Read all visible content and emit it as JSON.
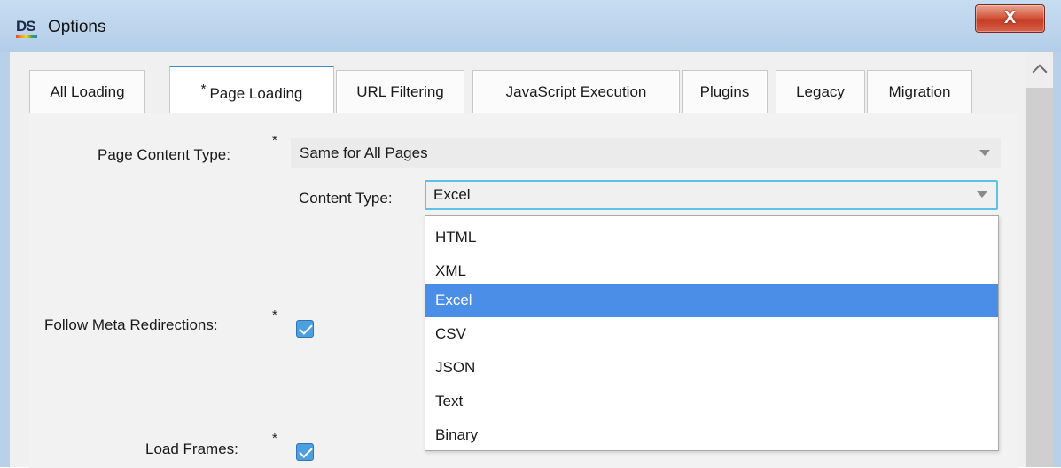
{
  "window": {
    "logo_text": "DS",
    "title": "Options",
    "close_label": "X"
  },
  "tabs": [
    {
      "label": "All Loading",
      "active": false,
      "modified": false
    },
    {
      "label": "Page Loading",
      "active": true,
      "modified": true,
      "marker": "*"
    },
    {
      "label": "URL Filtering",
      "active": false,
      "modified": false
    },
    {
      "label": "JavaScript Execution",
      "active": false,
      "modified": false
    },
    {
      "label": "Plugins",
      "active": false,
      "modified": false
    },
    {
      "label": "Legacy",
      "active": false,
      "modified": false
    },
    {
      "label": "Migration",
      "active": false,
      "modified": false
    }
  ],
  "form": {
    "page_content_type": {
      "label": "Page Content Type:",
      "marker": "*",
      "value": "Same for All Pages"
    },
    "content_type": {
      "label": "Content Type:",
      "value": "Excel",
      "options": [
        "HTML",
        "XML",
        "Excel",
        "CSV",
        "JSON",
        "Text",
        "Binary"
      ],
      "selected_index": 2
    },
    "follow_meta_redirections": {
      "label": "Follow Meta Redirections:",
      "marker": "*",
      "checked": true
    },
    "load_frames": {
      "label": "Load Frames:",
      "marker": "*",
      "checked": true
    }
  },
  "colors": {
    "accent": "#4a8ee7",
    "focus_border": "#5cc2ea",
    "titlebar": "#bcd4ec",
    "close_button": "#c33b23"
  },
  "icons": {
    "app_logo": "ds-logo-icon",
    "close": "close-icon",
    "scroll_up": "chevron-up-icon",
    "dropdown_arrow": "chevron-down-icon",
    "checkbox": "checkmark-icon"
  }
}
